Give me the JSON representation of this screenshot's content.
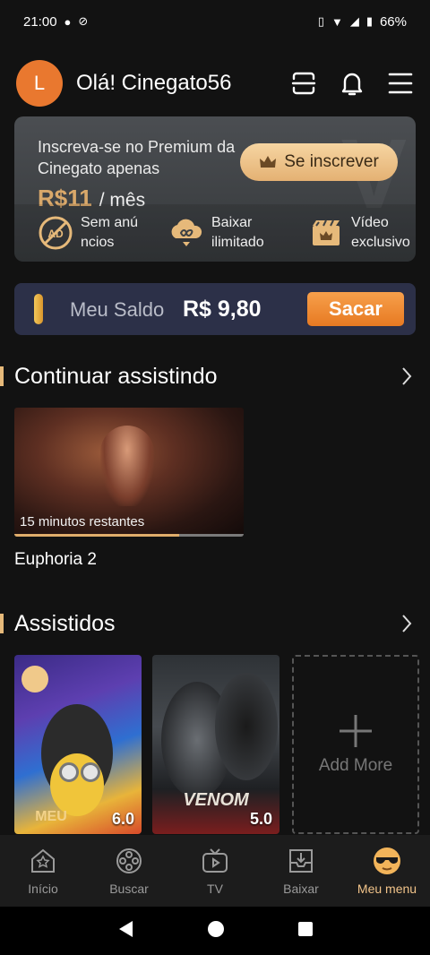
{
  "status_bar": {
    "time": "21:00",
    "battery": "66%"
  },
  "header": {
    "avatar_letter": "L",
    "greeting": "Olá! Cinegato56"
  },
  "premium": {
    "text": "Inscreva-se no Premium da Cinegato apenas",
    "price": "R$11",
    "price_unit": "/ mês",
    "subscribe_label": "Se inscrever",
    "benefits": [
      {
        "label": "Sem anú ncios",
        "icon": "no-ads-icon"
      },
      {
        "label": "Baixar ilimitado",
        "icon": "infinite-download-icon"
      },
      {
        "label": "Vídeo exclusivo",
        "icon": "exclusive-video-icon"
      }
    ]
  },
  "balance": {
    "label": "Meu Saldo",
    "value": "R$ 9,80",
    "withdraw_label": "Sacar"
  },
  "continue_watching": {
    "title": "Continuar assistindo",
    "items": [
      {
        "title": "Euphoria 2",
        "remaining": "15 minutos restantes",
        "progress": 0.72
      }
    ]
  },
  "watched": {
    "title": "Assistidos",
    "items": [
      {
        "rating": "6.0",
        "poster_text": "MEU"
      },
      {
        "rating": "5.0",
        "poster_text": "VENOM"
      }
    ],
    "add_more_label": "Add More"
  },
  "bottom_nav": [
    {
      "label": "Início",
      "icon": "home-icon",
      "active": false
    },
    {
      "label": "Buscar",
      "icon": "film-reel-icon",
      "active": false
    },
    {
      "label": "TV",
      "icon": "tv-icon",
      "active": false
    },
    {
      "label": "Baixar",
      "icon": "download-icon",
      "active": false
    },
    {
      "label": "Meu menu",
      "icon": "cool-face-icon",
      "active": true
    }
  ],
  "colors": {
    "accent": "#e6b97a",
    "avatar": "#e9782f",
    "withdraw": "#ee8a33",
    "balance_bg": "#2c3048"
  }
}
